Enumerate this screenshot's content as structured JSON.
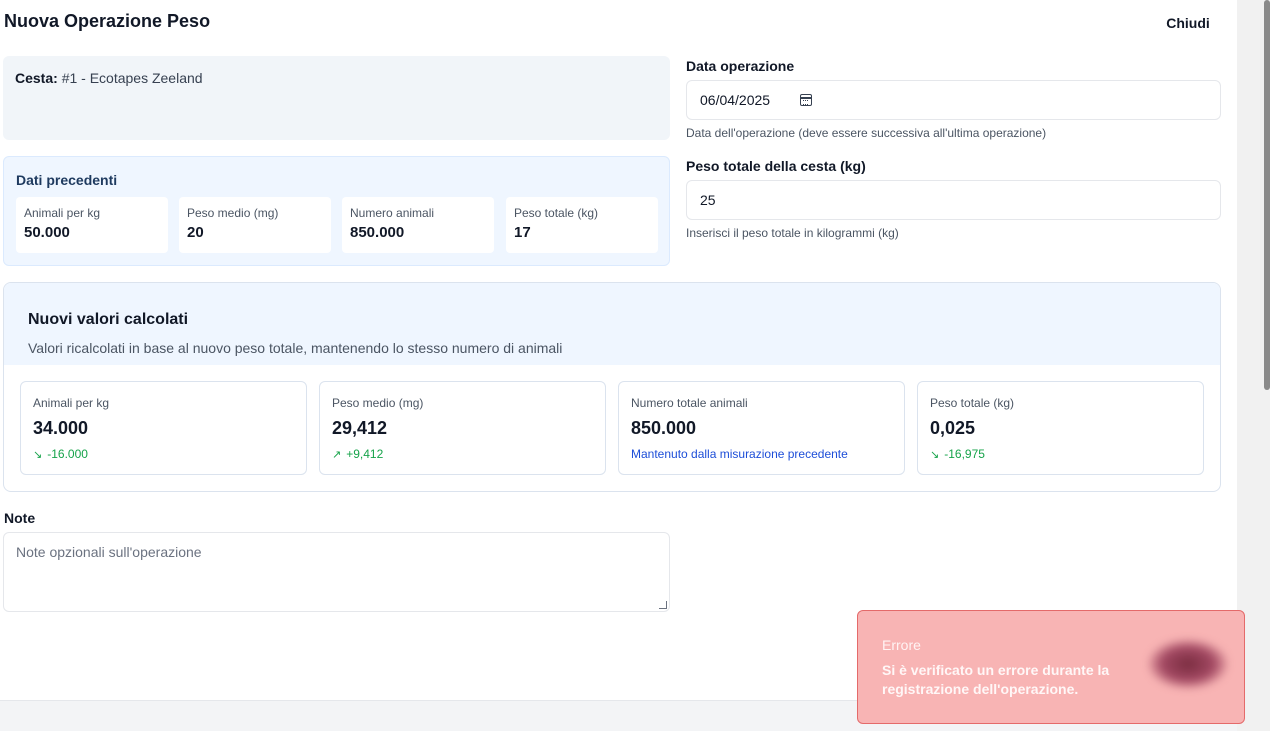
{
  "dialog": {
    "title": "Nuova Operazione Peso",
    "close_label": "Chiudi"
  },
  "basket": {
    "label": "Cesta:",
    "value": "#1 - Ecotapes Zeeland"
  },
  "previous": {
    "title": "Dati precedenti",
    "cards": [
      {
        "label": "Animali per kg",
        "value": "50.000"
      },
      {
        "label": "Peso medio (mg)",
        "value": "20"
      },
      {
        "label": "Numero animali",
        "value": "850.000"
      },
      {
        "label": "Peso totale (kg)",
        "value": "17"
      }
    ]
  },
  "date_field": {
    "label": "Data operazione",
    "value": "06/04/2025",
    "help": "Data dell'operazione (deve essere successiva all'ultima operazione)",
    "icon": "calendar-icon"
  },
  "weight_field": {
    "label": "Peso totale della cesta (kg)",
    "value": "25",
    "help": "Inserisci il peso totale in kilogrammi (kg)"
  },
  "calculated": {
    "title": "Nuovi valori calcolati",
    "subtitle": "Valori ricalcolati in base al nuovo peso totale, mantenendo lo stesso numero di animali",
    "cards": [
      {
        "label": "Animali per kg",
        "value": "34.000",
        "delta": "-16.000",
        "trend": "trend-down-icon"
      },
      {
        "label": "Peso medio (mg)",
        "value": "29,412",
        "delta": "+9,412",
        "trend": "trend-up-icon"
      },
      {
        "label": "Numero totale animali",
        "value": "850.000",
        "delta": "Mantenuto dalla misurazione precedente"
      },
      {
        "label": "Peso totale (kg)",
        "value": "0,025",
        "delta": "-16,975",
        "trend": "trend-down-icon"
      }
    ],
    "colors": {
      "positive": "#16a34a",
      "info": "#1d4ed8"
    }
  },
  "notes": {
    "label": "Note",
    "placeholder": "Note opzionali sull'operazione"
  },
  "toast": {
    "title": "Errore",
    "message": "Si è verificato un errore durante la registrazione dell'operazione.",
    "color": "#f8b4b4"
  }
}
